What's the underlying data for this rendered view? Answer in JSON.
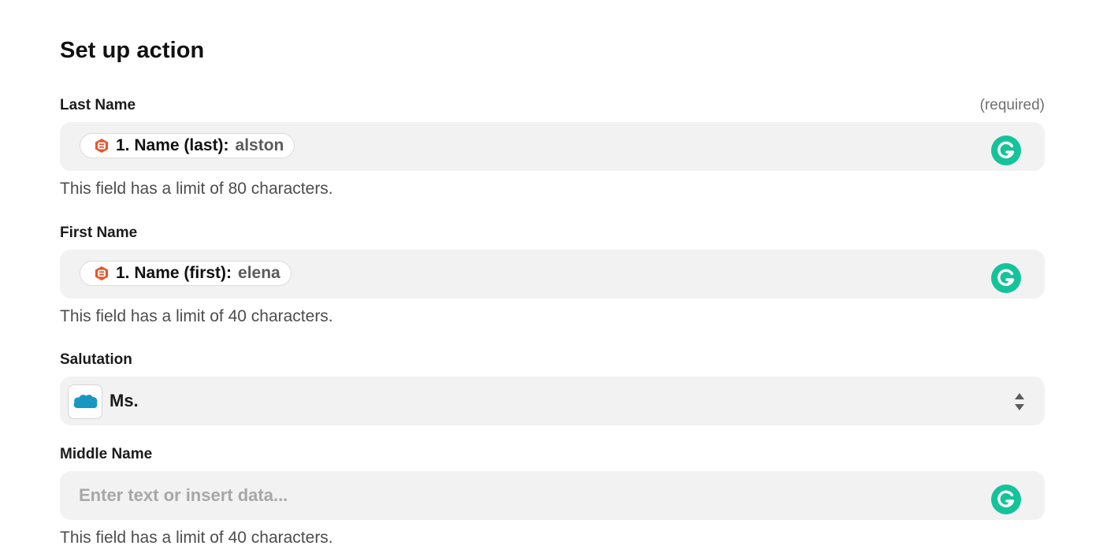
{
  "title": "Set up action",
  "fields": {
    "last_name": {
      "label": "Last Name",
      "required": "(required)",
      "pill_key": "1. Name (last):",
      "pill_value": "alston",
      "hint": "This field has a limit of 80 characters."
    },
    "first_name": {
      "label": "First Name",
      "pill_key": "1. Name (first):",
      "pill_value": "elena",
      "hint": "This field has a limit of 40 characters."
    },
    "salutation": {
      "label": "Salutation",
      "value": "Ms.",
      "logo_text": "salesforce"
    },
    "middle_name": {
      "label": "Middle Name",
      "placeholder": "Enter text or insert data...",
      "hint": "This field has a limit of 40 characters."
    }
  },
  "colors": {
    "source_app_icon": "#e8552a",
    "grammarly": "#15c39a",
    "salesforce": "#1798c1"
  },
  "icons": {
    "source_app": "form-app-icon",
    "grammarly": "grammarly-icon",
    "salesforce": "salesforce-logo-icon",
    "select": "select-arrows-icon"
  }
}
